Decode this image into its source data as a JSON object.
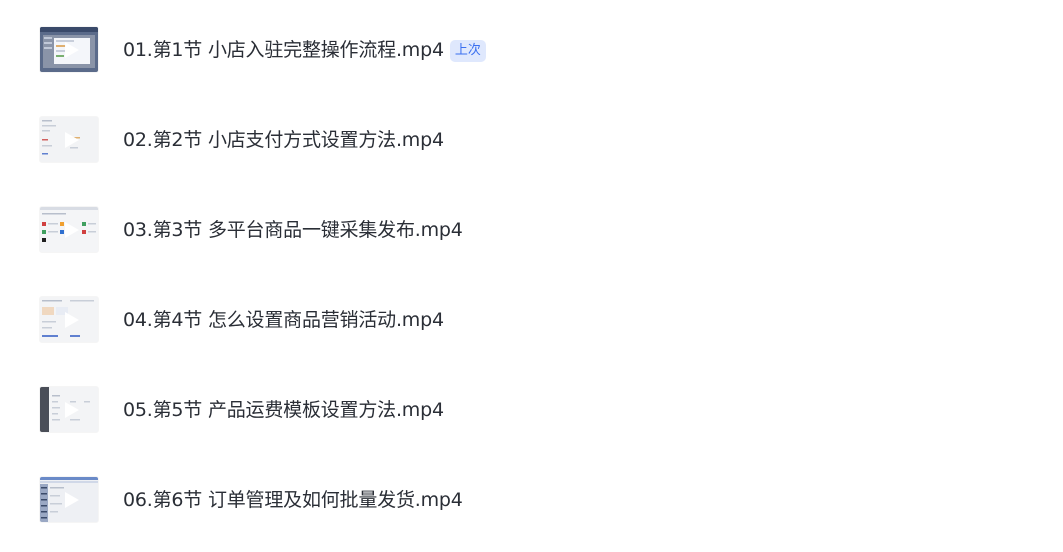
{
  "files": [
    {
      "name": "01.第1节 小店入驻完整操作流程.mp4",
      "badge": "上次",
      "thumb_icon": "video-thumbnail-icon"
    },
    {
      "name": "02.第2节 小店支付方式设置方法.mp4",
      "thumb_icon": "video-thumbnail-icon"
    },
    {
      "name": "03.第3节 多平台商品一键采集发布.mp4",
      "thumb_icon": "video-thumbnail-icon"
    },
    {
      "name": "04.第4节 怎么设置商品营销活动.mp4",
      "thumb_icon": "video-thumbnail-icon"
    },
    {
      "name": "05.第5节 产品运费模板设置方法.mp4",
      "thumb_icon": "video-thumbnail-icon"
    },
    {
      "name": "06.第6节 订单管理及如何批量发货.mp4",
      "thumb_icon": "video-thumbnail-icon"
    }
  ],
  "colors": {
    "text": "#2a2e36",
    "badge_text": "#3a6ff0",
    "badge_bg": "#dfe8fd",
    "background": "#ffffff"
  }
}
